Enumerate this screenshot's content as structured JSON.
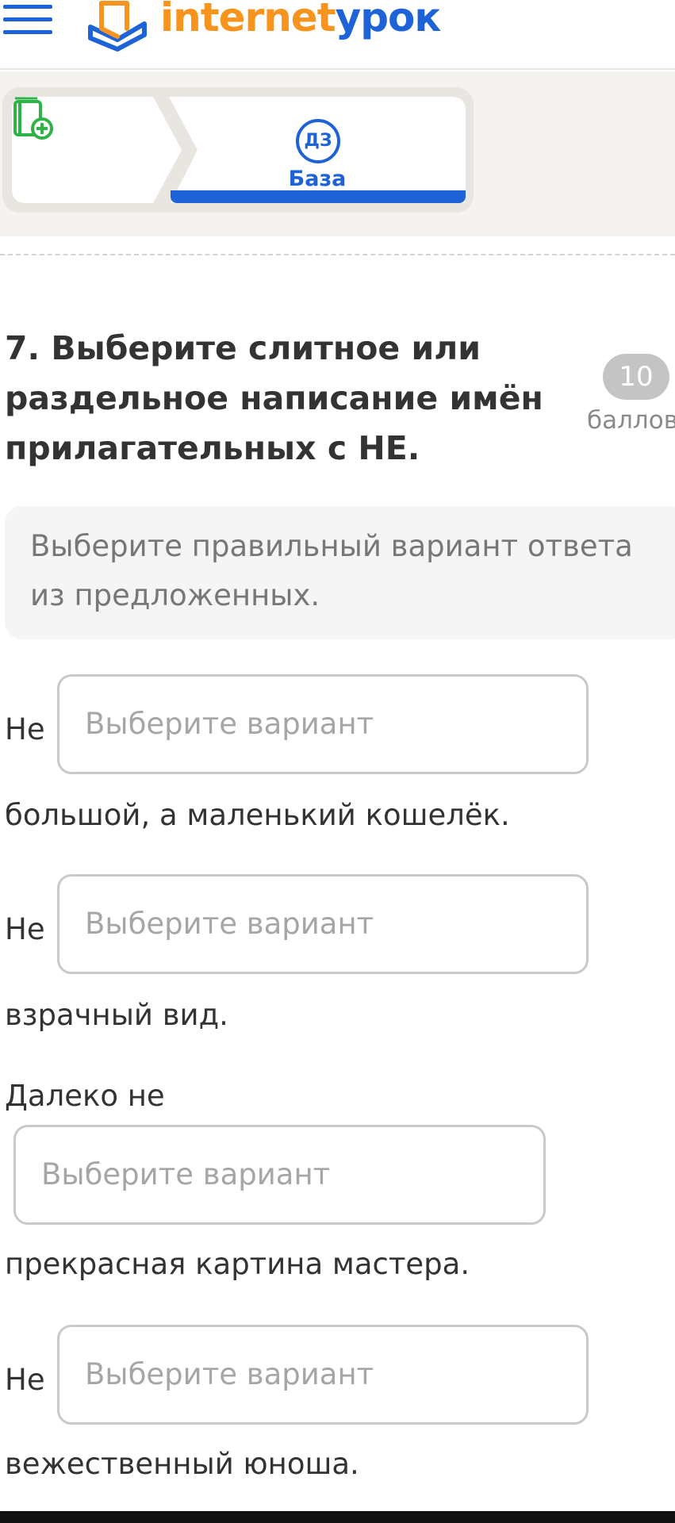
{
  "header": {
    "logo_part1": "internet",
    "logo_part2": "урок",
    "colors": {
      "brand_blue": "#1d62d6",
      "brand_orange": "#f7941d"
    },
    "icons": [
      "menu-icon",
      "logo-book-icon"
    ]
  },
  "tabs": [
    {
      "icon": "book-add-icon",
      "label": ""
    },
    {
      "icon_text": "ДЗ",
      "label": "База",
      "active": true
    }
  ],
  "question": {
    "title": "7. Выберите слитное или раздельное написание имён прилагательных с НЕ.",
    "score_value": "10",
    "score_label": "баллов",
    "instruction": "Выберите правильный вариант ответа из предложенных."
  },
  "items": [
    {
      "prefix": "Не",
      "select_placeholder": "Выберите вариант",
      "suffix": "большой, а маленький кошелёк."
    },
    {
      "prefix": "Не",
      "select_placeholder": "Выберите вариант",
      "suffix": "взрачный вид."
    },
    {
      "prefix": "Далеко не",
      "select_placeholder": "Выберите вариант",
      "suffix": "прекрасная картина мастера."
    },
    {
      "prefix": "Не",
      "select_placeholder": "Выберите вариант",
      "suffix": "вежественный юноша."
    }
  ]
}
